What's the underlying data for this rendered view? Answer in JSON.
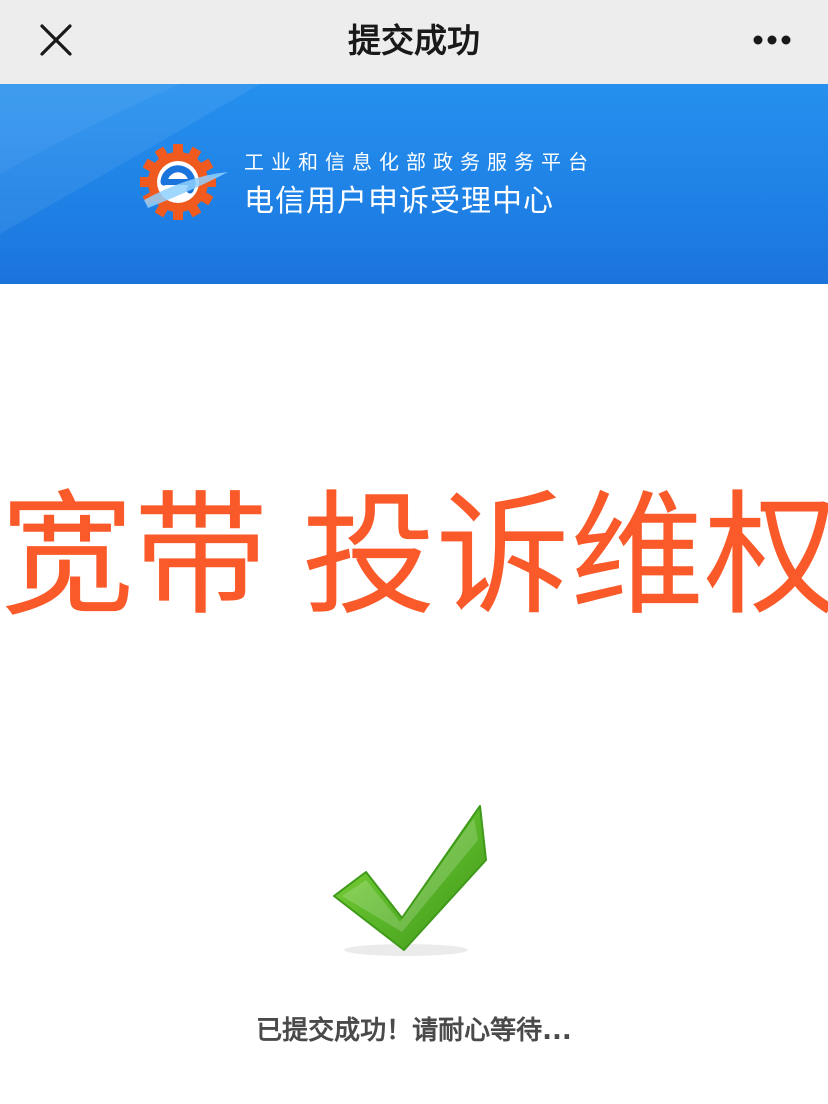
{
  "navbar": {
    "title": "提交成功",
    "close_icon": "close-icon",
    "more_icon": "more-icon"
  },
  "banner": {
    "logo_icon": "gear-e-logo-icon",
    "org_name": "工业和信息化部政务服务平台",
    "center_name": "电信用户申诉受理中心"
  },
  "headline": {
    "part1": "宽带",
    "part2": "投诉维权"
  },
  "status": {
    "check_icon": "check-icon",
    "message": "已提交成功！请耐心等待..."
  },
  "colors": {
    "navbar_bg": "#ededed",
    "banner_blue": "#1f82e6",
    "headline_orange": "#fa5a2a",
    "check_green": "#5cb82a",
    "logo_orange": "#f05a1e"
  }
}
